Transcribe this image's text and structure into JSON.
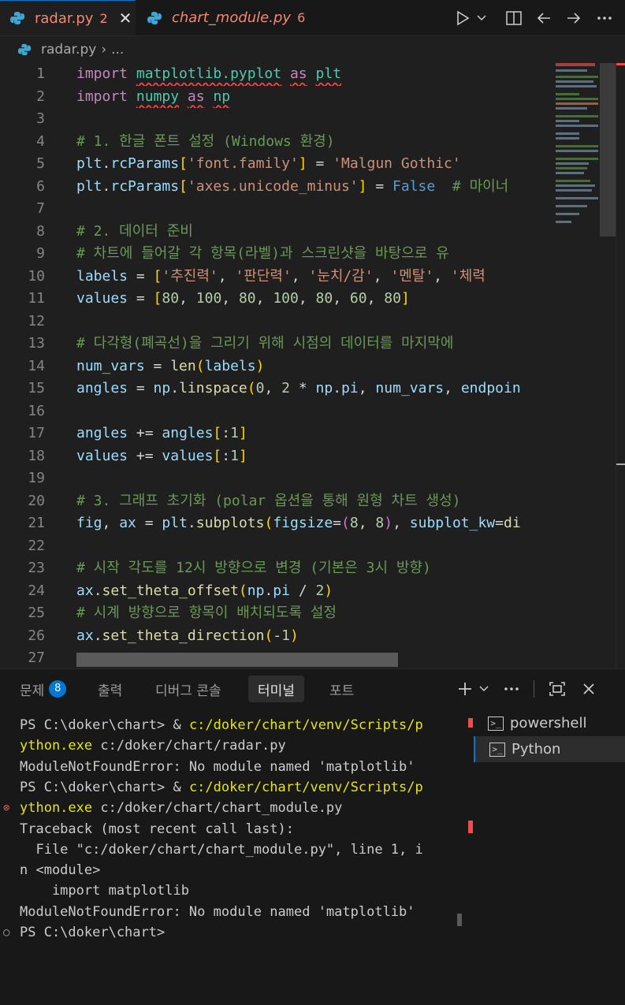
{
  "tabs": [
    {
      "name": "radar.py",
      "count": "2",
      "active": true
    },
    {
      "name": "chart_module.py",
      "count": "6",
      "active": false
    }
  ],
  "breadcrumb": {
    "file": "radar.py",
    "more": "..."
  },
  "editor_lines": [
    {
      "n": "1",
      "tokens": [
        [
          "kw",
          "import"
        ],
        [
          "op",
          " "
        ],
        [
          "mod",
          "matplotlib.pyplot",
          "sq"
        ],
        [
          "op",
          " "
        ],
        [
          "kw",
          "as",
          "sq"
        ],
        [
          "op",
          " "
        ],
        [
          "mod",
          "plt",
          "sq"
        ]
      ]
    },
    {
      "n": "2",
      "tokens": [
        [
          "kw",
          "import"
        ],
        [
          "op",
          " "
        ],
        [
          "mod",
          "numpy",
          "sq"
        ],
        [
          "op",
          " "
        ],
        [
          "kw",
          "as",
          "sq"
        ],
        [
          "op",
          " "
        ],
        [
          "mod",
          "np",
          "sq"
        ]
      ]
    },
    {
      "n": "3",
      "tokens": []
    },
    {
      "n": "4",
      "tokens": [
        [
          "com",
          "# 1. 한글 폰트 설정 (Windows 환경)"
        ]
      ]
    },
    {
      "n": "5",
      "tokens": [
        [
          "var",
          "plt"
        ],
        [
          "op",
          "."
        ],
        [
          "var",
          "rcParams"
        ],
        [
          "br",
          "["
        ],
        [
          "str",
          "'font.family'"
        ],
        [
          "br",
          "]"
        ],
        [
          "op",
          " = "
        ],
        [
          "str",
          "'Malgun Gothic'"
        ]
      ]
    },
    {
      "n": "6",
      "tokens": [
        [
          "var",
          "plt"
        ],
        [
          "op",
          "."
        ],
        [
          "var",
          "rcParams"
        ],
        [
          "br",
          "["
        ],
        [
          "str",
          "'axes.unicode_minus'"
        ],
        [
          "br",
          "]"
        ],
        [
          "op",
          " = "
        ],
        [
          "bool",
          "False"
        ],
        [
          "op",
          "  "
        ],
        [
          "com",
          "# 마이너"
        ]
      ]
    },
    {
      "n": "7",
      "tokens": []
    },
    {
      "n": "8",
      "tokens": [
        [
          "com",
          "# 2. 데이터 준비"
        ]
      ]
    },
    {
      "n": "9",
      "tokens": [
        [
          "com",
          "# 차트에 들어갈 각 항목(라벨)과 스크린샷을 바탕으로 유"
        ]
      ]
    },
    {
      "n": "10",
      "tokens": [
        [
          "var",
          "labels"
        ],
        [
          "op",
          " = "
        ],
        [
          "br",
          "["
        ],
        [
          "str",
          "'추진력'"
        ],
        [
          "op",
          ", "
        ],
        [
          "str",
          "'판단력'"
        ],
        [
          "op",
          ", "
        ],
        [
          "str",
          "'눈치/감'"
        ],
        [
          "op",
          ", "
        ],
        [
          "str",
          "'멘탈'"
        ],
        [
          "op",
          ", "
        ],
        [
          "str",
          "'체력"
        ]
      ]
    },
    {
      "n": "11",
      "tokens": [
        [
          "var",
          "values"
        ],
        [
          "op",
          " = "
        ],
        [
          "br",
          "["
        ],
        [
          "num",
          "80"
        ],
        [
          "op",
          ", "
        ],
        [
          "num",
          "100"
        ],
        [
          "op",
          ", "
        ],
        [
          "num",
          "80"
        ],
        [
          "op",
          ", "
        ],
        [
          "num",
          "100"
        ],
        [
          "op",
          ", "
        ],
        [
          "num",
          "80"
        ],
        [
          "op",
          ", "
        ],
        [
          "num",
          "60"
        ],
        [
          "op",
          ", "
        ],
        [
          "num",
          "80"
        ],
        [
          "br",
          "]"
        ]
      ]
    },
    {
      "n": "12",
      "tokens": []
    },
    {
      "n": "13",
      "tokens": [
        [
          "com",
          "# 다각형(폐곡선)을 그리기 위해 시점의 데이터를 마지막에"
        ]
      ]
    },
    {
      "n": "14",
      "tokens": [
        [
          "var",
          "num_vars"
        ],
        [
          "op",
          " = "
        ],
        [
          "fn",
          "len"
        ],
        [
          "br",
          "("
        ],
        [
          "var",
          "labels"
        ],
        [
          "br",
          ")"
        ]
      ]
    },
    {
      "n": "15",
      "tokens": [
        [
          "var",
          "angles"
        ],
        [
          "op",
          " = "
        ],
        [
          "var",
          "np"
        ],
        [
          "op",
          "."
        ],
        [
          "fn",
          "linspace"
        ],
        [
          "br",
          "("
        ],
        [
          "num",
          "0"
        ],
        [
          "op",
          ", "
        ],
        [
          "num",
          "2"
        ],
        [
          "op",
          " * "
        ],
        [
          "var",
          "np"
        ],
        [
          "op",
          "."
        ],
        [
          "var",
          "pi"
        ],
        [
          "op",
          ", "
        ],
        [
          "var",
          "num_vars"
        ],
        [
          "op",
          ", "
        ],
        [
          "var",
          "endpoin"
        ]
      ]
    },
    {
      "n": "16",
      "tokens": []
    },
    {
      "n": "17",
      "tokens": [
        [
          "var",
          "angles"
        ],
        [
          "op",
          " += "
        ],
        [
          "var",
          "angles"
        ],
        [
          "br",
          "["
        ],
        [
          "op",
          ":"
        ],
        [
          "num",
          "1"
        ],
        [
          "br",
          "]"
        ]
      ]
    },
    {
      "n": "18",
      "tokens": [
        [
          "var",
          "values"
        ],
        [
          "op",
          " += "
        ],
        [
          "var",
          "values"
        ],
        [
          "br",
          "["
        ],
        [
          "op",
          ":"
        ],
        [
          "num",
          "1"
        ],
        [
          "br",
          "]"
        ]
      ]
    },
    {
      "n": "19",
      "tokens": []
    },
    {
      "n": "20",
      "tokens": [
        [
          "com",
          "# 3. 그래프 초기화 (polar 옵션을 통해 원형 차트 생성)"
        ]
      ]
    },
    {
      "n": "21",
      "tokens": [
        [
          "var",
          "fig"
        ],
        [
          "op",
          ", "
        ],
        [
          "var",
          "ax"
        ],
        [
          "op",
          " = "
        ],
        [
          "var",
          "plt"
        ],
        [
          "op",
          "."
        ],
        [
          "fn",
          "subplots"
        ],
        [
          "br",
          "("
        ],
        [
          "var",
          "figsize"
        ],
        [
          "op",
          "="
        ],
        [
          "br2",
          "("
        ],
        [
          "num",
          "8"
        ],
        [
          "op",
          ", "
        ],
        [
          "num",
          "8"
        ],
        [
          "br2",
          ")"
        ],
        [
          "op",
          ", "
        ],
        [
          "var",
          "subplot_kw"
        ],
        [
          "op",
          "="
        ],
        [
          "fn",
          "di"
        ]
      ]
    },
    {
      "n": "22",
      "tokens": []
    },
    {
      "n": "23",
      "tokens": [
        [
          "com",
          "# 시작 각도를 12시 방향으로 변경 (기본은 3시 방향)"
        ]
      ]
    },
    {
      "n": "24",
      "tokens": [
        [
          "var",
          "ax"
        ],
        [
          "op",
          "."
        ],
        [
          "fn",
          "set_theta_offset"
        ],
        [
          "br",
          "("
        ],
        [
          "var",
          "np"
        ],
        [
          "op",
          "."
        ],
        [
          "var",
          "pi"
        ],
        [
          "op",
          " / "
        ],
        [
          "num",
          "2"
        ],
        [
          "br",
          ")"
        ]
      ]
    },
    {
      "n": "25",
      "tokens": [
        [
          "com",
          "# 시계 방향으로 항목이 배치되도록 설정"
        ]
      ]
    },
    {
      "n": "26",
      "tokens": [
        [
          "var",
          "ax"
        ],
        [
          "op",
          "."
        ],
        [
          "fn",
          "set_theta_direction"
        ],
        [
          "br",
          "("
        ],
        [
          "op",
          "-"
        ],
        [
          "num",
          "1"
        ],
        [
          "br",
          ")"
        ]
      ]
    },
    {
      "n": "27",
      "tokens": []
    }
  ],
  "panel_tabs": {
    "problems": "문제",
    "problems_count": "8",
    "output": "출력",
    "debug": "디버그 콘솔",
    "terminal": "터미널",
    "ports": "포트"
  },
  "terminal_lines": [
    {
      "text": "PS C:\\doker\\chart> & ",
      "exe": "c:/doker/chart/venv/Scripts/p"
    },
    {
      "text": "",
      "exe": "ython.exe",
      "rest": " c:/doker/chart/radar.py"
    },
    {
      "text": "ModuleNotFoundError: No module named 'matplotlib'"
    },
    {
      "text": "PS C:\\doker\\chart> & ",
      "exe": "c:/doker/chart/venv/Scripts/p"
    },
    {
      "text": "",
      "exe": "ython.exe",
      "rest": " c:/doker/chart/chart_module.py"
    },
    {
      "text": "Traceback (most recent call last):"
    },
    {
      "text": "  File \"c:/doker/chart/chart_module.py\", line 1, i"
    },
    {
      "text": "n <module>"
    },
    {
      "text": "    import matplotlib"
    },
    {
      "text": "ModuleNotFoundError: No module named 'matplotlib'"
    },
    {
      "text": "PS C:\\doker\\chart>"
    }
  ],
  "terminal_list": [
    {
      "name": "powershell",
      "selected": false
    },
    {
      "name": "Python",
      "selected": true
    }
  ],
  "colors": {
    "accent": "#0078d4",
    "error": "#f14c4c",
    "tab_error_text": "#f48771"
  },
  "icons": [
    "python-file-icon",
    "close-icon",
    "run-icon",
    "chevron-down-icon",
    "split-editor-icon",
    "back-icon",
    "forward-icon",
    "more-icon",
    "plus-icon",
    "maximize-icon",
    "terminal-icon",
    "error-icon"
  ]
}
